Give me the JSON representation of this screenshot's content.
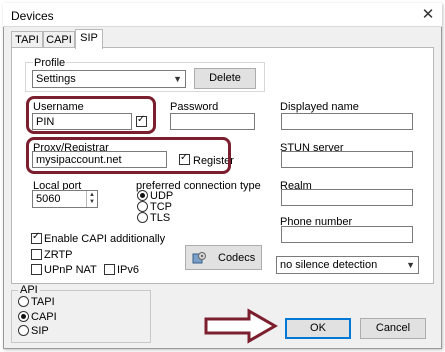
{
  "window": {
    "title": "Devices",
    "close_glyph": "✕"
  },
  "tabs": [
    "TAPI",
    "CAPI",
    "SIP"
  ],
  "profile": {
    "label": "Profile",
    "value": "Settings",
    "delete_label": "Delete"
  },
  "username": {
    "label": "Username",
    "value": "PIN"
  },
  "password": {
    "label": "Password",
    "value": ""
  },
  "displayed_name": {
    "label": "Displayed name",
    "value": ""
  },
  "proxy": {
    "label": "Proxy/Registrar",
    "value": "mysipaccount.net",
    "register_label": "Register"
  },
  "stun": {
    "label": "STUN server",
    "value": ""
  },
  "local_port": {
    "label": "Local port",
    "value": "5060"
  },
  "connection_type": {
    "label": "preferred connection type",
    "options": [
      "UDP",
      "TCP",
      "TLS"
    ],
    "selected": "UDP"
  },
  "realm": {
    "label": "Realm",
    "value": ""
  },
  "phone_number": {
    "label": "Phone number",
    "value": ""
  },
  "options": {
    "enable_capi": "Enable CAPI additionally",
    "zrtp": "ZRTP",
    "upnp": "UPnP NAT",
    "ipv6": "IPv6"
  },
  "codecs_label": "Codecs",
  "silence": {
    "value": "no silence detection"
  },
  "api": {
    "label": "API",
    "options": [
      "TAPI",
      "CAPI",
      "SIP"
    ],
    "selected": "CAPI"
  },
  "buttons": {
    "ok": "OK",
    "cancel": "Cancel"
  },
  "colors": {
    "highlight": "#7b1f2e",
    "accent": "#0078d7"
  }
}
